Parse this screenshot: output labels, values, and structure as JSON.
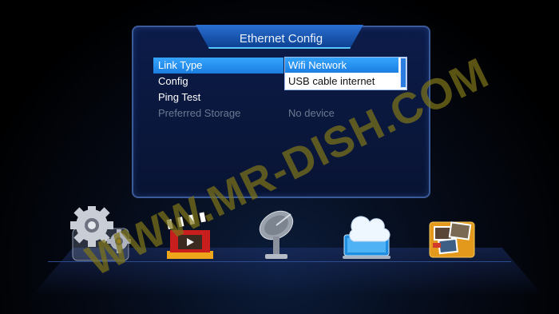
{
  "dialog": {
    "title": "Ethernet Config",
    "rows": [
      {
        "label": "Link Type",
        "value": ""
      },
      {
        "label": "Config",
        "value": ""
      },
      {
        "label": "Ping Test",
        "value": ""
      },
      {
        "label": "Preferred Storage",
        "value": "No device"
      }
    ],
    "dropdown": {
      "options": [
        "Wifi Network",
        "USB cable internet"
      ],
      "selected": "Wifi Network"
    }
  },
  "dock": {
    "icons": [
      "settings-gears-icon",
      "media-clapperboard-icon",
      "satellite-dish-icon",
      "cloud-network-icon",
      "photo-album-icon"
    ]
  },
  "watermark": "WWW.MR-DISH.COM",
  "colors": {
    "highlight": "#2a93f2",
    "dialog_border": "#3b5a9a",
    "dialog_bg": "#0a173c",
    "watermark": "#7d7319"
  }
}
